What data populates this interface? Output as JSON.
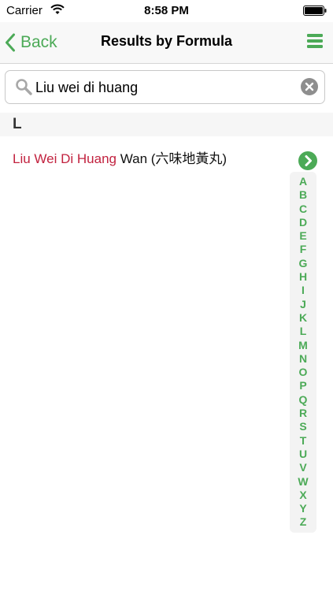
{
  "status_bar": {
    "carrier": "Carrier",
    "time": "8:58 PM"
  },
  "nav": {
    "back_label": "Back",
    "title": "Results by Formula"
  },
  "search": {
    "value": "Liu wei di huang"
  },
  "section": {
    "letter": "L"
  },
  "results": [
    {
      "match": "Liu Wei Di Huang",
      "rest": " Wan (六味地黃丸)"
    }
  ],
  "index": {
    "letters": [
      "A",
      "B",
      "C",
      "D",
      "E",
      "F",
      "G",
      "H",
      "I",
      "J",
      "K",
      "L",
      "M",
      "N",
      "O",
      "P",
      "Q",
      "R",
      "S",
      "T",
      "U",
      "V",
      "W",
      "X",
      "Y",
      "Z"
    ]
  },
  "colors": {
    "accent": "#4caa57",
    "match": "#c2223f"
  },
  "icons": {
    "back": "chevron-left-icon",
    "menu": "hamburger-menu-icon",
    "search": "magnifier-icon",
    "clear": "clear-x-icon",
    "index_go": "chevron-right-circle-icon"
  }
}
